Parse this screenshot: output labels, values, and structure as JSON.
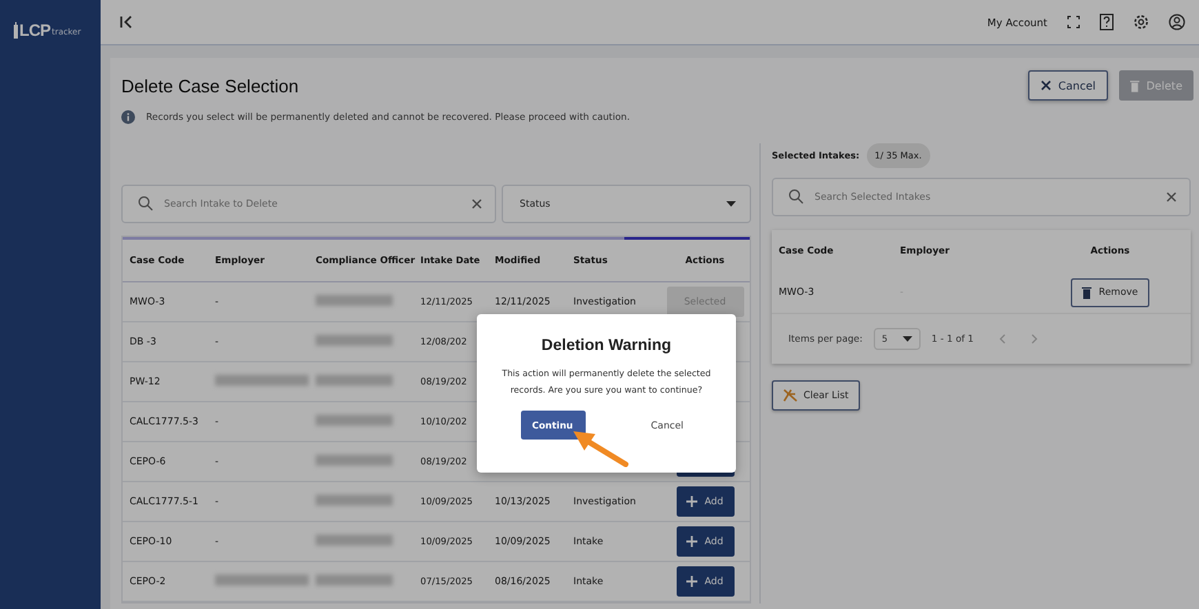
{
  "sidebar": {
    "logo": "LCP",
    "logo_suffix": "tracker"
  },
  "topbar": {
    "account_link": "My Account"
  },
  "page": {
    "title": "Delete Case Selection",
    "notice": "Records you select will be permanently deleted and cannot be recovered. Please proceed with caution.",
    "buttons": [
      {
        "kind": "cancel",
        "label": "Cancel",
        "disabled": false
      },
      {
        "kind": "delete",
        "label": "Delete",
        "disabled": true
      }
    ]
  },
  "left": {
    "search": {
      "placeholder": "Search Intake to Delete"
    },
    "status_filter": {
      "placeholder": "Status"
    },
    "table": {
      "columns": [
        "Case Code",
        "Employer",
        "Compliance Officer",
        "Intake Date",
        "Modified",
        "Status",
        "Actions"
      ],
      "rows": [
        {
          "case_code": "MWO-3",
          "employer": "-",
          "intake_date": "12/11/2025",
          "modified": "12/11/2025",
          "status": "Investigation",
          "action": {
            "kind": "selected",
            "label": "Selected"
          }
        },
        {
          "case_code": "DB -3",
          "employer": "-",
          "intake_date": "12/08/202"
        },
        {
          "case_code": "PW-12",
          "intake_date": "08/19/202"
        },
        {
          "case_code": "CALC1777.5-3",
          "employer": "-",
          "intake_date": "10/10/202"
        },
        {
          "case_code": "CEPO-6",
          "employer": "-",
          "intake_date": "08/19/202",
          "action": {
            "kind": "add"
          }
        },
        {
          "case_code": "CALC1777.5-1",
          "employer": "-",
          "intake_date": "10/09/2025",
          "modified": "10/13/2025",
          "status": "Investigation",
          "action": {
            "kind": "add",
            "label": "Add"
          }
        },
        {
          "case_code": "CEPO-10",
          "employer": "-",
          "intake_date": "10/09/2025",
          "modified": "10/09/2025",
          "status": "Intake",
          "action": {
            "kind": "add",
            "label": "Add"
          }
        },
        {
          "case_code": "CEPO-2",
          "intake_date": "07/15/2025",
          "modified": "08/16/2025",
          "status": "Intake",
          "action": {
            "kind": "add",
            "label": "Add"
          }
        }
      ]
    }
  },
  "right": {
    "selected_label": "Selected Intakes:",
    "selected_count": "1/ 35 Max.",
    "search": {
      "placeholder": "Search Selected Intakes"
    },
    "table": {
      "columns": [
        "Case Code",
        "Employer",
        "Actions"
      ],
      "rows": [
        {
          "case_code": "MWO-3",
          "employer": "-",
          "action": "Remove"
        }
      ]
    },
    "pagination": {
      "label": "Items per page:",
      "page_size": "5",
      "range": "1 - 1 of 1"
    },
    "clear_button": "Clear List"
  },
  "dialog": {
    "title": "Deletion Warning",
    "message": "This action will permanently delete the selected records. Are you sure you want to continue?",
    "confirm": "Continu",
    "cancel": "Cancel"
  }
}
